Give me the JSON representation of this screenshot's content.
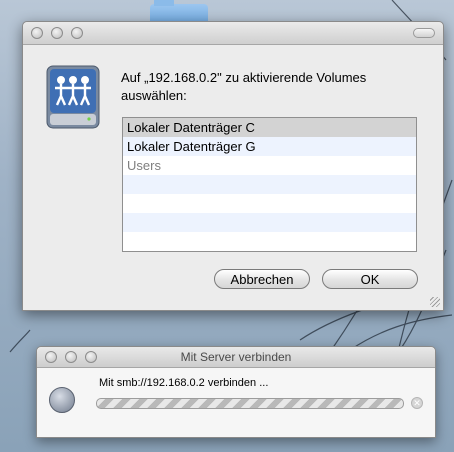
{
  "dialog": {
    "prompt": "Auf „192.168.0.2\" zu aktivierende Volumes auswählen:",
    "volumes": [
      {
        "label": "Lokaler Datenträger C"
      },
      {
        "label": "Lokaler Datenträger G"
      },
      {
        "label": "Users"
      }
    ],
    "cancel_label": "Abbrechen",
    "ok_label": "OK"
  },
  "connect_window": {
    "title": "Mit Server verbinden",
    "status": "Mit smb://192.168.0.2 verbinden ..."
  }
}
